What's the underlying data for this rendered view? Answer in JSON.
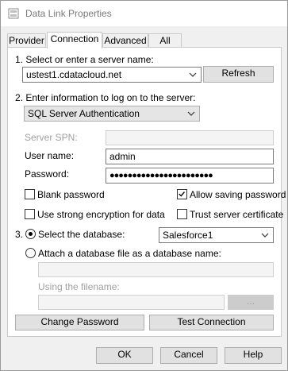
{
  "window": {
    "title": "Data Link Properties"
  },
  "tabs": [
    {
      "label": "Provider"
    },
    {
      "label": "Connection"
    },
    {
      "label": "Advanced"
    },
    {
      "label": "All"
    }
  ],
  "section1": {
    "label": "1. Select or enter a server name:",
    "server_value": "ustest1.cdatacloud.net",
    "refresh_label": "Refresh"
  },
  "section2": {
    "label": "2. Enter information to log on to the server:",
    "auth_value": "SQL Server Authentication",
    "server_spn_label": "Server SPN:",
    "server_spn_value": "",
    "username_label": "User name:",
    "username_value": "admin",
    "password_label": "Password:",
    "password_value": "●●●●●●●●●●●●●●●●●●●●●●●",
    "blank_password_label": "Blank password",
    "allow_saving_label": "Allow saving password",
    "strong_encryption_label": "Use strong encryption for data",
    "trust_cert_label": "Trust server certificate"
  },
  "section3": {
    "number": "3.",
    "select_db_label": "Select the database:",
    "database_value": "Salesforce1",
    "attach_label": "Attach a database file as a database name:",
    "attach_value": "",
    "using_filename_label": "Using the filename:",
    "filename_value": "",
    "browse_label": "..."
  },
  "buttons": {
    "change_password": "Change Password",
    "test_connection": "Test Connection",
    "ok": "OK",
    "cancel": "Cancel",
    "help": "Help"
  }
}
